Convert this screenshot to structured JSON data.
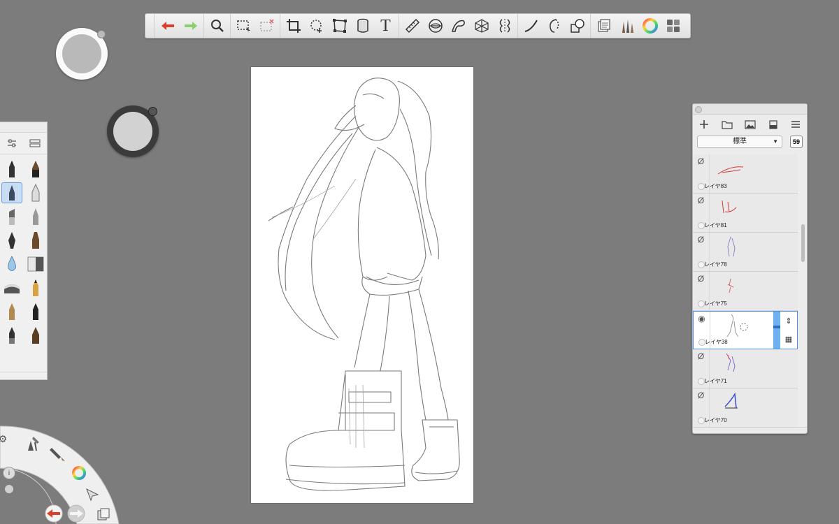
{
  "toolbar": {
    "tools": [
      {
        "name": "undo-icon",
        "group": 1
      },
      {
        "name": "redo-icon",
        "group": 1
      },
      {
        "name": "zoom-icon",
        "group": 2
      },
      {
        "name": "select-icon",
        "group": 3
      },
      {
        "name": "select-clear-icon",
        "group": 3
      },
      {
        "name": "crop-icon",
        "group": 4
      },
      {
        "name": "transform-icon",
        "group": 4
      },
      {
        "name": "distort-icon",
        "group": 4
      },
      {
        "name": "fill-icon",
        "group": 4
      },
      {
        "name": "text-icon",
        "group": 4
      },
      {
        "name": "ruler-icon",
        "group": 5
      },
      {
        "name": "ellipse-guide-icon",
        "group": 5
      },
      {
        "name": "french-curve-icon",
        "group": 5
      },
      {
        "name": "perspective-icon",
        "group": 5
      },
      {
        "name": "symmetry-icon",
        "group": 5
      },
      {
        "name": "steady-stroke-icon",
        "group": 6
      },
      {
        "name": "predictive-stroke-icon",
        "group": 6
      },
      {
        "name": "shapes-icon",
        "group": 6
      },
      {
        "name": "copic-library-icon",
        "group": 7
      },
      {
        "name": "brush-library-icon",
        "group": 7
      },
      {
        "name": "color-wheel-icon",
        "group": 7
      },
      {
        "name": "grid-view-icon",
        "group": 7
      }
    ],
    "undo_color": "#d9402b",
    "redo_color": "#8ccf6e",
    "text_glyph": "T"
  },
  "layers": {
    "blend_mode": "標準",
    "opacity": "59",
    "items": [
      {
        "name": "レイヤ83",
        "visible": false,
        "thumb_color": "#d23b3b"
      },
      {
        "name": "レイヤ81",
        "visible": false,
        "thumb_color": "#d23b3b"
      },
      {
        "name": "レイヤ78",
        "visible": false,
        "thumb_color": "#8a86c8"
      },
      {
        "name": "レイヤ75",
        "visible": false,
        "thumb_color": "#d86a6a"
      },
      {
        "name": "レイヤ38",
        "visible": true,
        "thumb_color": "#999999",
        "active": true
      },
      {
        "name": "レイヤ71",
        "visible": false,
        "thumb_color": "#8a6ad0"
      },
      {
        "name": "レイヤ70",
        "visible": false,
        "thumb_color": "#3b4fc8"
      }
    ]
  },
  "colors": {
    "background": "#7c7c7c",
    "accent": "#4a90e2",
    "puck_light": "#b9b9b9",
    "puck_dark": "#d2d2d2"
  }
}
